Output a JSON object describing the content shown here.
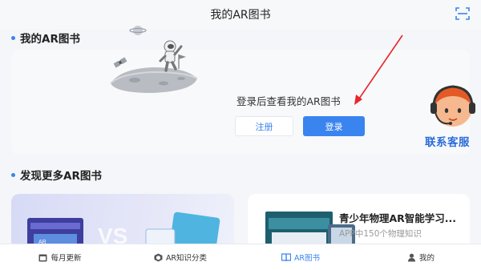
{
  "header": {
    "title": "我的AR图书",
    "scan_icon": "scan-icon"
  },
  "my_books": {
    "section_title": "我的AR图书",
    "login_hint": "登录后查看我的AR图书",
    "register_label": "注册",
    "login_label": "登录"
  },
  "customer_service": {
    "label": "联系客服",
    "icon": "customer-service-avatar"
  },
  "discover": {
    "section_title": "发现更多AR图书",
    "featured": {
      "title": "青少年物理AR智能学习...",
      "subtitle": "APP中150个物理知识"
    }
  },
  "tabbar": {
    "items": [
      {
        "label": "每月更新",
        "icon": "calendar-icon",
        "active": false
      },
      {
        "label": "AR知识分类",
        "icon": "category-icon",
        "active": false
      },
      {
        "label": "AR图书",
        "icon": "book-icon",
        "active": true
      },
      {
        "label": "我的",
        "icon": "person-icon",
        "active": false
      }
    ]
  },
  "colors": {
    "accent": "#3a84f0",
    "annotation_arrow": "#e8262b"
  }
}
